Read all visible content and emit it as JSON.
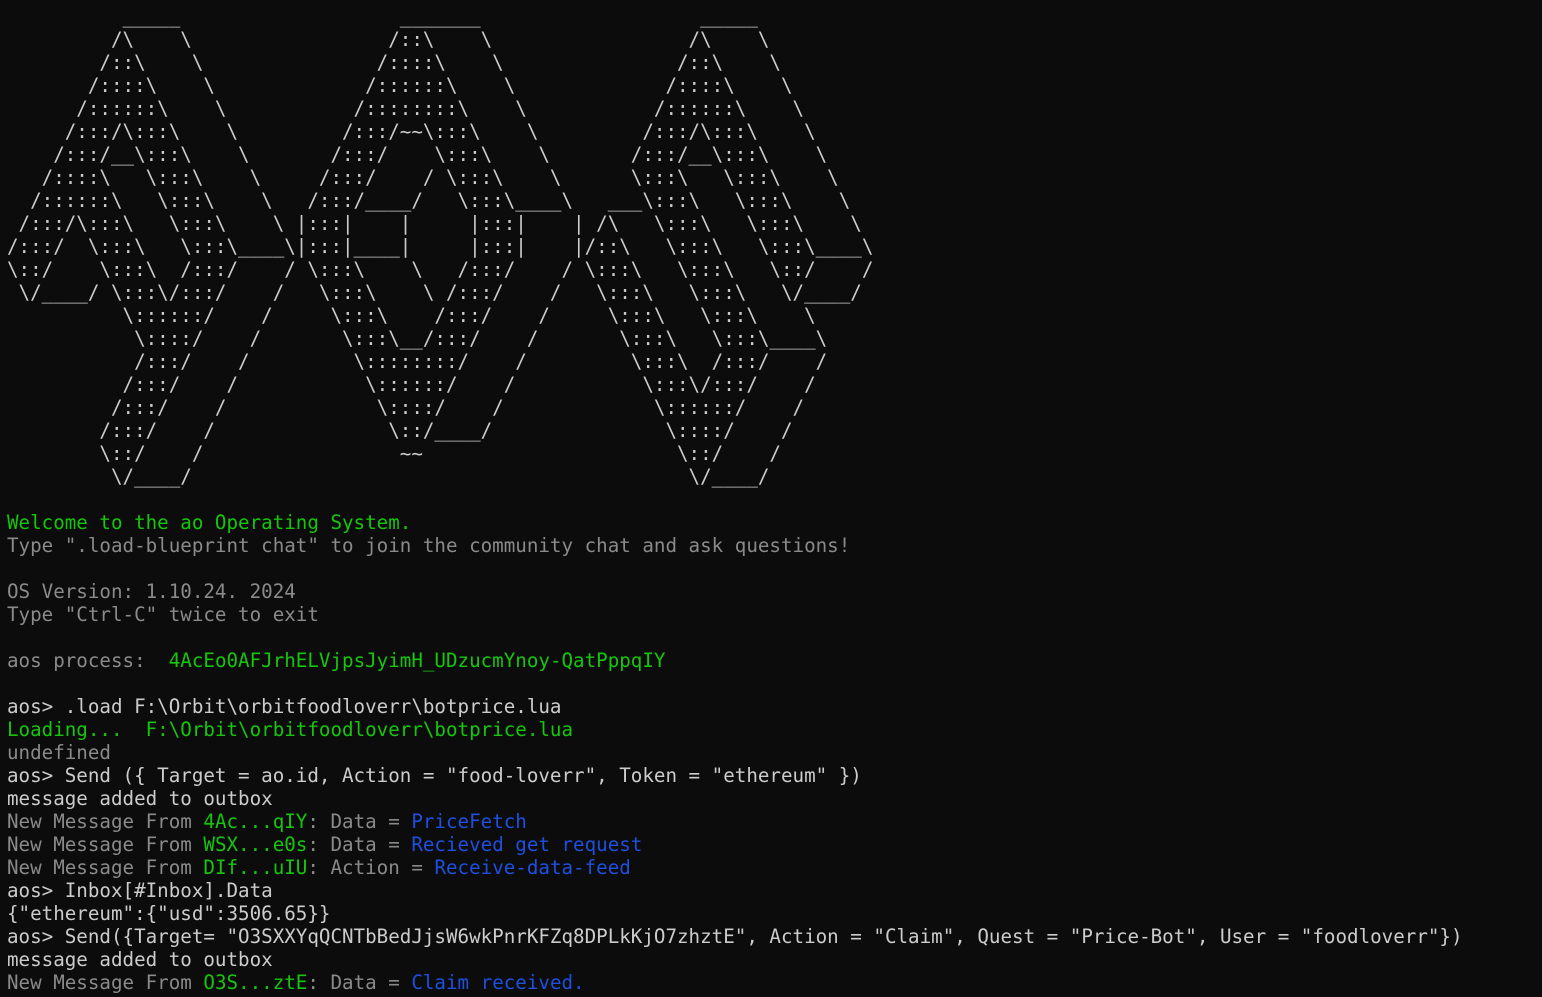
{
  "banner_art": "          _____                   _______                   _____          \n         /\\    \\                 /::\\    \\                 /\\    \\         \n        /::\\    \\               /::::\\    \\               /::\\    \\        \n       /::::\\    \\             /::::::\\    \\             /::::\\    \\       \n      /::::::\\    \\           /::::::::\\    \\           /::::::\\    \\      \n     /:::/\\:::\\    \\         /:::/~~\\:::\\    \\         /:::/\\:::\\    \\     \n    /:::/__\\:::\\    \\       /:::/    \\:::\\    \\       /:::/__\\:::\\    \\    \n   /::::\\   \\:::\\    \\     /:::/    / \\:::\\    \\      \\:::\\   \\:::\\    \\   \n  /::::::\\   \\:::\\    \\   /:::/____/   \\:::\\____\\   ___\\:::\\   \\:::\\    \\  \n /:::/\\:::\\   \\:::\\    \\ |:::|    |     |:::|    | /\\   \\:::\\   \\:::\\    \\ \n/:::/  \\:::\\   \\:::\\____\\|:::|____|     |:::|    |/::\\   \\:::\\   \\:::\\____\\\n\\::/    \\:::\\  /:::/    / \\:::\\    \\   /:::/    / \\:::\\   \\:::\\   \\::/    /\n \\/____/ \\:::\\/:::/    /   \\:::\\    \\ /:::/    /   \\:::\\   \\:::\\   \\/____/ \n          \\::::::/    /     \\:::\\    /:::/    /     \\:::\\   \\:::\\    \\     \n           \\::::/    /       \\:::\\__/:::/    /       \\:::\\   \\:::\\____\\    \n           /:::/    /         \\::::::::/    /         \\:::\\  /:::/    /    \n          /:::/    /           \\::::::/    /           \\:::\\/:::/    /     \n         /:::/    /             \\::::/    /             \\::::::/    /      \n        /:::/    /               \\::/____/               \\::::/    /       \n        \\::/    /                 ~~                      \\::/    /        \n         \\/____/                                           \\/____/         ",
  "lines": [
    {
      "segments": [
        {
          "text": "Welcome to the ao Operating System.",
          "color": "green"
        }
      ]
    },
    {
      "segments": [
        {
          "text": "Type \".load-blueprint chat\" to join the community chat and ask questions!",
          "color": "gray"
        }
      ]
    },
    {
      "segments": []
    },
    {
      "segments": [
        {
          "text": "OS Version: 1.10.24. 2024",
          "color": "gray"
        }
      ]
    },
    {
      "segments": [
        {
          "text": "Type \"Ctrl-C\" twice to exit",
          "color": "gray"
        }
      ]
    },
    {
      "segments": []
    },
    {
      "segments": [
        {
          "text": "aos process:  ",
          "color": "gray"
        },
        {
          "text": "4AcEo0AFJrhELVjpsJyimH_UDzucmYnoy-QatPppqIY",
          "color": "green"
        }
      ]
    },
    {
      "segments": []
    },
    {
      "segments": [
        {
          "text": "aos> .load F:\\Orbit\\orbitfoodloverr\\botprice.lua",
          "color": "white"
        }
      ]
    },
    {
      "segments": [
        {
          "text": "Loading...  F:\\Orbit\\orbitfoodloverr\\botprice.lua",
          "color": "green"
        }
      ]
    },
    {
      "segments": [
        {
          "text": "undefined",
          "color": "gray"
        }
      ]
    },
    {
      "segments": [
        {
          "text": "aos> Send ({ Target = ao.id, Action = \"food-loverr\", Token = \"ethereum\" })",
          "color": "white"
        }
      ]
    },
    {
      "segments": [
        {
          "text": "message added to outbox",
          "color": "white"
        }
      ]
    },
    {
      "segments": [
        {
          "text": "New Message From ",
          "color": "gray"
        },
        {
          "text": "4Ac...qIY",
          "color": "green"
        },
        {
          "text": ": Data = ",
          "color": "gray"
        },
        {
          "text": "PriceFetch",
          "color": "blue"
        }
      ]
    },
    {
      "segments": [
        {
          "text": "New Message From ",
          "color": "gray"
        },
        {
          "text": "WSX...e0s",
          "color": "green"
        },
        {
          "text": ": Data = ",
          "color": "gray"
        },
        {
          "text": "Recieved get request",
          "color": "blue"
        }
      ]
    },
    {
      "segments": [
        {
          "text": "New Message From ",
          "color": "gray"
        },
        {
          "text": "DIf...uIU",
          "color": "green"
        },
        {
          "text": ": Action = ",
          "color": "gray"
        },
        {
          "text": "Receive-data-feed",
          "color": "blue"
        }
      ]
    },
    {
      "segments": [
        {
          "text": "aos> Inbox[#Inbox].Data",
          "color": "white"
        }
      ]
    },
    {
      "segments": [
        {
          "text": "{\"ethereum\":{\"usd\":3506.65}}",
          "color": "white"
        }
      ]
    },
    {
      "segments": [
        {
          "text": "aos> Send({Target= \"O3SXXYqQCNTbBedJjsW6wkPnrKFZq8DPLkKjO7zhztE\", Action = \"Claim\", Quest = \"Price-Bot\", User = \"foodloverr\"})",
          "color": "white"
        }
      ]
    },
    {
      "segments": [
        {
          "text": "message added to outbox",
          "color": "white"
        }
      ]
    },
    {
      "segments": [
        {
          "text": "New Message From ",
          "color": "gray"
        },
        {
          "text": "O3S...ztE",
          "color": "green"
        },
        {
          "text": ": Data = ",
          "color": "gray"
        },
        {
          "text": "Claim received.",
          "color": "blue"
        }
      ]
    }
  ],
  "colors": {
    "background": "#0c0c0c",
    "white": "#cccccc",
    "gray": "#8a8a8a",
    "green": "#16c60c",
    "blue": "#1e4fe0"
  }
}
